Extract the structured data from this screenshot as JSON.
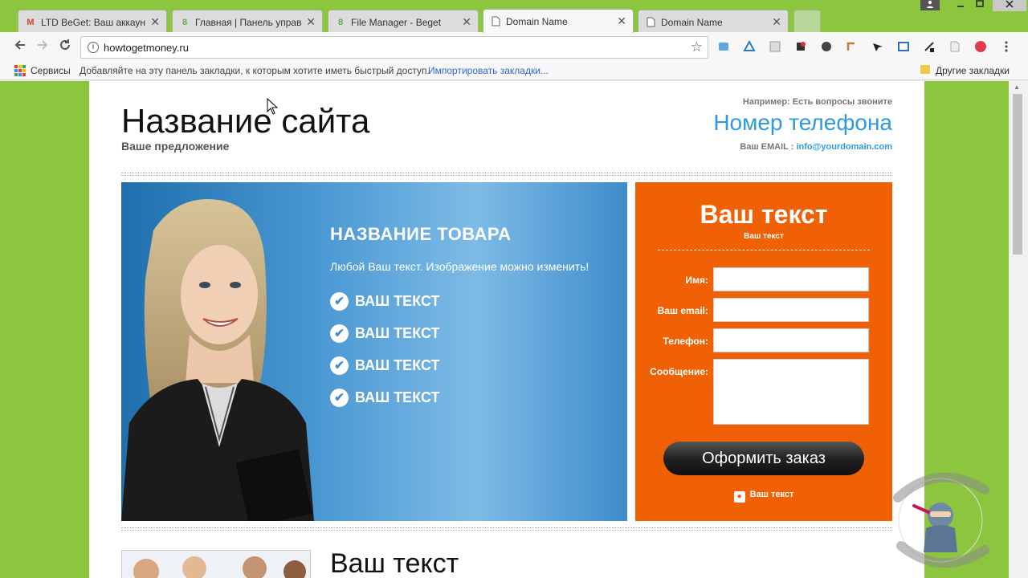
{
  "browser": {
    "tabs": [
      {
        "label": "LTD BeGet: Ваш аккаунт",
        "icon": "gmail-icon",
        "active": false
      },
      {
        "label": "Главная | Панель управ",
        "icon": "beget-icon",
        "active": false
      },
      {
        "label": "File Manager - Beget",
        "icon": "beget-icon",
        "active": false
      },
      {
        "label": "Domain Name",
        "icon": "page-icon",
        "active": true
      },
      {
        "label": "Domain Name",
        "icon": "page-icon",
        "active": false
      }
    ],
    "close_glyph": "✕",
    "url": "howtogetmoney.ru",
    "bookmarks": {
      "apps_label": "Сервисы",
      "hint": "Добавляйте на эту панель закладки, к которым хотите иметь быстрый доступ.",
      "import_link": "Импортировать закладки...",
      "other": "Другие закладки"
    }
  },
  "site": {
    "title": "Название сайта",
    "offer": "Ваше предложение",
    "header_note": "Например: Есть вопросы звоните",
    "phone": "Номер телефона",
    "email_label": "Ваш EMAIL : ",
    "email": "info@yourdomain.com"
  },
  "hero": {
    "title": "НАЗВАНИЕ ТОВАРА",
    "description": "Любой Ваш текст. Изображение можно изменить!",
    "items": [
      "ВАШ ТЕКСТ",
      "ВАШ ТЕКСТ",
      "ВАШ ТЕКСТ",
      "ВАШ ТЕКСТ"
    ]
  },
  "order_form": {
    "title": "Ваш текст",
    "subtitle": "Ваш текст",
    "fields": {
      "name": "Имя:",
      "email": "Ваш email:",
      "phone": "Телефон:",
      "message": "Сообщение:"
    },
    "submit": "Оформить заказ",
    "secure_note": "Ваш текст"
  },
  "section2": {
    "title": "Ваш текст"
  },
  "colors": {
    "chrome": "#8cc63f",
    "accent_blue": "#2e9bd9",
    "order_orange": "#f06105"
  }
}
